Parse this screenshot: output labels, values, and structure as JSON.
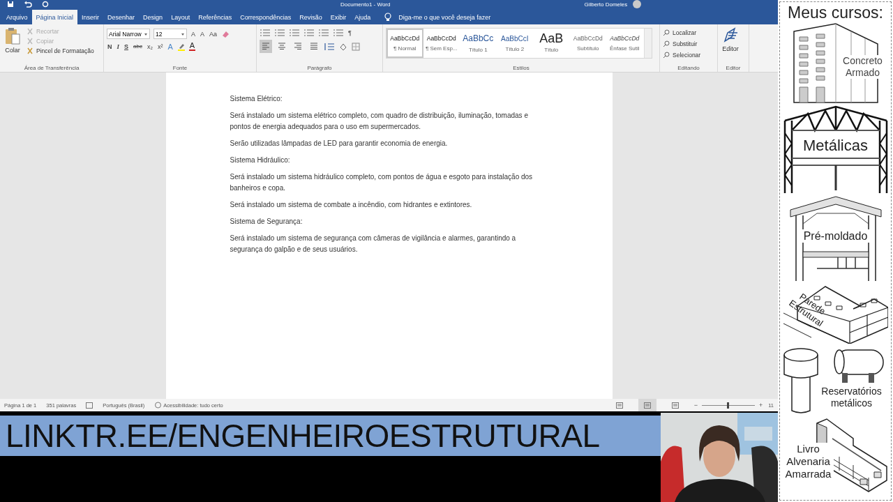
{
  "window": {
    "title": "Documento1 - Word",
    "user": "Gilberto Domeles"
  },
  "tabs": [
    {
      "label": "Arquivo",
      "selected": false
    },
    {
      "label": "Página Inicial",
      "selected": true
    },
    {
      "label": "Inserir",
      "selected": false
    },
    {
      "label": "Desenhar",
      "selected": false
    },
    {
      "label": "Design",
      "selected": false
    },
    {
      "label": "Layout",
      "selected": false
    },
    {
      "label": "Referências",
      "selected": false
    },
    {
      "label": "Correspondências",
      "selected": false
    },
    {
      "label": "Revisão",
      "selected": false
    },
    {
      "label": "Exibir",
      "selected": false
    },
    {
      "label": "Ajuda",
      "selected": false
    }
  ],
  "tell_me": {
    "placeholder": "Diga-me o que você deseja fazer"
  },
  "ribbon": {
    "clipboard": {
      "title": "Área de Transferência",
      "paste": "Colar",
      "actions": [
        {
          "label": "Recortar",
          "disabled": true
        },
        {
          "label": "Copiar",
          "disabled": true
        },
        {
          "label": "Pincel de Formatação",
          "disabled": false
        }
      ]
    },
    "font": {
      "title": "Fonte",
      "font_name": "Arial Narrow",
      "font_size": "12",
      "size_buttons": [
        "A",
        "A"
      ],
      "case_button": "Aa",
      "format_buttons": [
        "N",
        "I",
        "S",
        "abc",
        "x₂",
        "x²"
      ],
      "effects_button": "A",
      "color_button": "A"
    },
    "paragraph": {
      "title": "Parágrafo",
      "marks_button": "¶",
      "alignments": [
        {
          "selected": true
        },
        {
          "selected": false
        },
        {
          "selected": false
        },
        {
          "selected": false
        }
      ]
    },
    "styles": {
      "title": "Estilos",
      "items": [
        {
          "preview": "AaBbCcDd",
          "name": "¶ Normal",
          "selected": true
        },
        {
          "preview": "AaBbCcDd",
          "name": "¶ Sem Esp...",
          "selected": false
        },
        {
          "preview": "AaBbCc",
          "name": "Título 1",
          "selected": false
        },
        {
          "preview": "AaBbCcI",
          "name": "Título 2",
          "selected": false
        },
        {
          "preview": "AaB",
          "name": "Título",
          "selected": false
        },
        {
          "preview": "AaBbCcDd",
          "name": "Subtítulo",
          "selected": false
        },
        {
          "preview": "AaBbCcDd",
          "name": "Ênfase Sutil",
          "selected": false
        }
      ]
    },
    "editing": {
      "title": "Editando",
      "actions": [
        "Localizar",
        "Substituir",
        "Selecionar"
      ]
    },
    "editor": {
      "title": "Editor",
      "button": "Editor"
    }
  },
  "document": {
    "paragraphs": [
      "Sistema Elétrico:",
      "Será instalado um sistema elétrico completo, com quadro de distribuição, iluminação, tomadas e pontos de energia adequados para o uso em supermercados.",
      "Serão utilizadas lâmpadas de LED para garantir economia de energia.",
      "Sistema Hidráulico:",
      "Será instalado um sistema hidráulico completo, com pontos de água e esgoto para instalação dos banheiros e copa.",
      "Será instalado um sistema de combate a incêndio, com hidrantes e extintores.",
      "Sistema de Segurança:",
      "Será instalado um sistema de segurança com câmeras de vigilância e alarmes, garantindo a segurança do galpão e de seus usuários."
    ]
  },
  "status_bar": {
    "page": "Página 1 de 1",
    "words": "351 palavras",
    "language": "Português (Brasil)",
    "accessibility": "Acessibilidade: tudo certo",
    "views": [
      {
        "selected": false
      },
      {
        "selected": true
      },
      {
        "selected": false
      }
    ],
    "zoom": {
      "minus": "−",
      "plus": "+",
      "level": 0.48,
      "reading": "11"
    }
  },
  "banner": {
    "text": "LINKTR.EE/ENGENHEIROESTRUTURAL"
  },
  "courses": {
    "title": "Meus cursos:",
    "items": [
      {
        "kind": "building",
        "label": "Concreto Armado"
      },
      {
        "kind": "truss",
        "label": "Metálicas"
      },
      {
        "kind": "precast",
        "label": "Pré-moldado"
      },
      {
        "kind": "blocks",
        "label": "Parede Estrutural"
      },
      {
        "kind": "tanks",
        "label": "Reservatórios metálicos"
      },
      {
        "kind": "book",
        "label": "Livro Alvenaria Amarrada"
      }
    ]
  }
}
